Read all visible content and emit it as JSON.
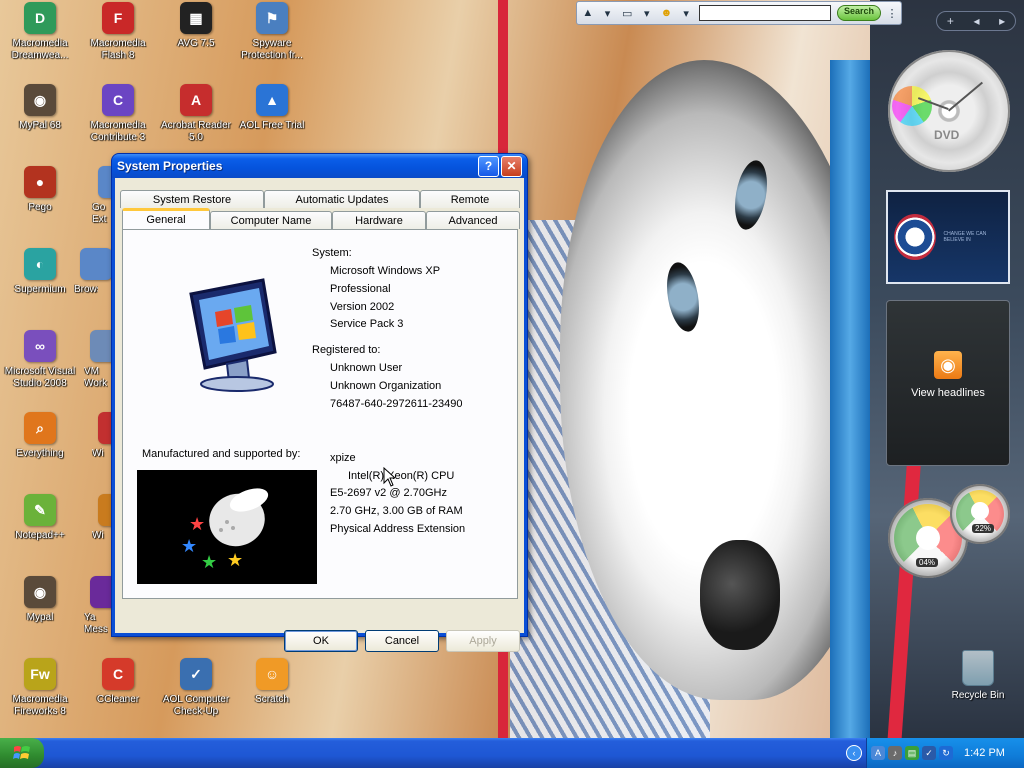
{
  "desktop": {
    "icons": [
      {
        "label": "Macromedia Dreamwea...",
        "icon": "dreamweaver-icon",
        "color": "#2f9a5a",
        "glyph": "D"
      },
      {
        "label": "Macromedia Flash 8",
        "icon": "flash-icon",
        "color": "#c92828",
        "glyph": "F"
      },
      {
        "label": "AVG 7.5",
        "icon": "avg-icon",
        "color": "#222222",
        "glyph": "▦"
      },
      {
        "label": "Spyware Protection fr...",
        "icon": "spyware-protection-icon",
        "color": "#4a7fc0",
        "glyph": "⚑"
      },
      {
        "label": "MyPal 68",
        "icon": "mypal-icon",
        "color": "#5a4a3a",
        "glyph": "◉"
      },
      {
        "label": "Macromedia Contribute 3",
        "icon": "contribute-icon",
        "color": "#6b45c3",
        "glyph": "C"
      },
      {
        "label": "Acrobat Reader 5.0",
        "icon": "acrobat-reader-icon",
        "color": "#c62d2d",
        "glyph": "A"
      },
      {
        "label": "AOL Free Trial",
        "icon": "aol-icon",
        "color": "#2a74d6",
        "glyph": "▲"
      },
      {
        "label": "Pego",
        "icon": "pego-icon",
        "color": "#b3331f",
        "glyph": "●"
      },
      {
        "label": "Supermium",
        "icon": "supermium-icon",
        "color": "#2aa3a1",
        "glyph": "◐"
      },
      {
        "label": "Microsoft Visual Studio 2008",
        "icon": "visual-studio-icon",
        "color": "#7a4fbd",
        "glyph": "∞"
      },
      {
        "label": "Everything",
        "icon": "everything-search-icon",
        "color": "#e0761c",
        "glyph": "⌕"
      },
      {
        "label": "Notepad++",
        "icon": "notepad-plus-plus-icon",
        "color": "#6bb23a",
        "glyph": "✎"
      },
      {
        "label": "Mypal",
        "icon": "mypal-icon",
        "color": "#5a4a3a",
        "glyph": "◉"
      },
      {
        "label": "Macromedia Fireworks 8",
        "icon": "fireworks-icon",
        "color": "#b9a41a",
        "glyph": "Fw"
      },
      {
        "label": "CCleaner",
        "icon": "ccleaner-icon",
        "color": "#d53a2a",
        "glyph": "C"
      },
      {
        "label": "AOL Computer Check-Up",
        "icon": "aol-checkup-icon",
        "color": "#3a6fb0",
        "glyph": "✓"
      },
      {
        "label": "Scratch",
        "icon": "scratch-cat-icon",
        "color": "#f09a26",
        "glyph": "☺"
      }
    ],
    "partial_icons": [
      {
        "label": "Go\nExt",
        "icon": "partial-icon",
        "color": "#5a87c8"
      },
      {
        "label": "Brows",
        "icon": "partial-icon",
        "color": "#5a87c8"
      },
      {
        "label": "VM\nWork",
        "icon": "vmware-icon",
        "color": "#6d8bb7"
      },
      {
        "label": "Wi",
        "icon": "partial-icon",
        "color": "#c23030"
      },
      {
        "label": "Wi",
        "icon": "partial-icon",
        "color": "#c97b1e"
      },
      {
        "label": "Ya\nMess",
        "icon": "yahoo-messenger-icon",
        "color": "#6a2a9a"
      }
    ],
    "recycle_bin_label": "Recycle Bin"
  },
  "toolbar": {
    "search_placeholder": "",
    "search_button": "Search"
  },
  "gadgets": {
    "dvd_label": "DVD",
    "obama_text": "CHANGE WE CAN BELIEVE IN",
    "headlines_label": "View headlines",
    "cpu_meter_pct": "04%",
    "mem_meter_pct": "22%"
  },
  "window": {
    "title": "System Properties",
    "tabs_row1": [
      "System Restore",
      "Automatic Updates",
      "Remote"
    ],
    "tabs_row2": [
      "General",
      "Computer Name",
      "Hardware",
      "Advanced"
    ],
    "active_tab": "General",
    "system_heading": "System:",
    "system_lines": [
      "Microsoft Windows XP",
      "Professional",
      "Version 2002",
      "Service Pack 3"
    ],
    "registered_heading": "Registered to:",
    "registered_lines": [
      "Unknown User",
      "Unknown Organization",
      "76487-640-2972611-23490"
    ],
    "manufacturer_heading": "Manufactured and supported by:",
    "computer_lines": [
      "xpize",
      "Intel(R) Xeon(R) CPU",
      "E5-2697 v2 @ 2.70GHz",
      "2.70 GHz, 3.00 GB of RAM",
      "Physical Address Extension"
    ],
    "buttons": {
      "ok": "OK",
      "cancel": "Cancel",
      "apply": "Apply"
    }
  },
  "taskbar": {
    "clock": "1:42 PM"
  }
}
